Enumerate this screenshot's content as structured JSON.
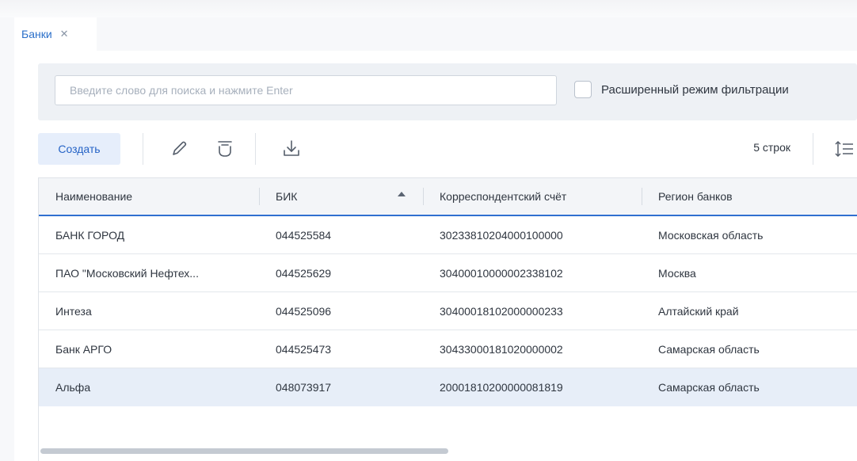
{
  "tabs": [
    {
      "label": "Банки",
      "close_icon": "close-icon"
    }
  ],
  "search": {
    "placeholder": "Введите слово для поиска и нажмите Enter",
    "value": ""
  },
  "advanced_filter": {
    "label": "Расширенный режим фильтрации",
    "checked": false
  },
  "toolbar": {
    "create_label": "Создать",
    "icons": [
      "edit-icon",
      "delete-icon",
      "download-icon",
      "row-height-icon"
    ],
    "rows_count": "5 строк"
  },
  "table": {
    "columns": [
      {
        "label": "Наименование"
      },
      {
        "label": "БИК",
        "sort": "ascending"
      },
      {
        "label": "Корреспондентский счёт"
      },
      {
        "label": "Регион банков"
      }
    ],
    "rows": [
      {
        "name": "БАНК ГОРОД",
        "bik": "044525584",
        "account": "30233810204000100000",
        "region": "Московская область",
        "selected": false
      },
      {
        "name": "ПАО \"Московский Нефтех...",
        "bik": "044525629",
        "account": "30400010000002338102",
        "region": "Москва",
        "selected": false
      },
      {
        "name": "Интеза",
        "bik": "044525096",
        "account": "30400018102000000233",
        "region": "Алтайский край",
        "selected": false
      },
      {
        "name": "Банк АРГО",
        "bik": "044525473",
        "account": "30433000181020000002",
        "region": "Самарская область",
        "selected": false
      },
      {
        "name": "Альфа",
        "bik": "048073917",
        "account": "20001810200000081819",
        "region": "Самарская область",
        "selected": true
      }
    ]
  },
  "colors": {
    "accent": "#2f6fd0",
    "tab_text": "#2a6fc9",
    "selected_row": "#e7eef8",
    "filter_panel": "#eef1f5"
  }
}
